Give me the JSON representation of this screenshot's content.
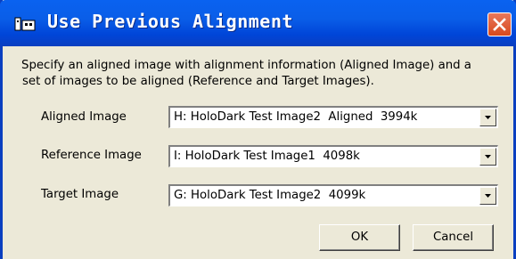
{
  "window": {
    "title": "Use Previous Alignment"
  },
  "dialog": {
    "description_line1": "Specify an aligned image with alignment information (Aligned Image) and a",
    "description_line2": "set of images to be aligned (Reference and Target Images).",
    "fields": [
      {
        "label": "Aligned Image",
        "value": "H: HoloDark Test Image2  Aligned  3994k"
      },
      {
        "label": "Reference Image",
        "value": "I: HoloDark Test Image1  4098k"
      },
      {
        "label": "Target Image",
        "value": "G: HoloDark Test Image2  4099k"
      }
    ],
    "ok_label": "OK",
    "cancel_label": "Cancel"
  },
  "icons": {
    "title": "dialog-app-icon",
    "close": "close-icon",
    "dropdown": "chevron-down-icon"
  },
  "colors": {
    "titlebar": "#0a5ee8",
    "close": "#d8491c",
    "face": "#ece9d8"
  }
}
